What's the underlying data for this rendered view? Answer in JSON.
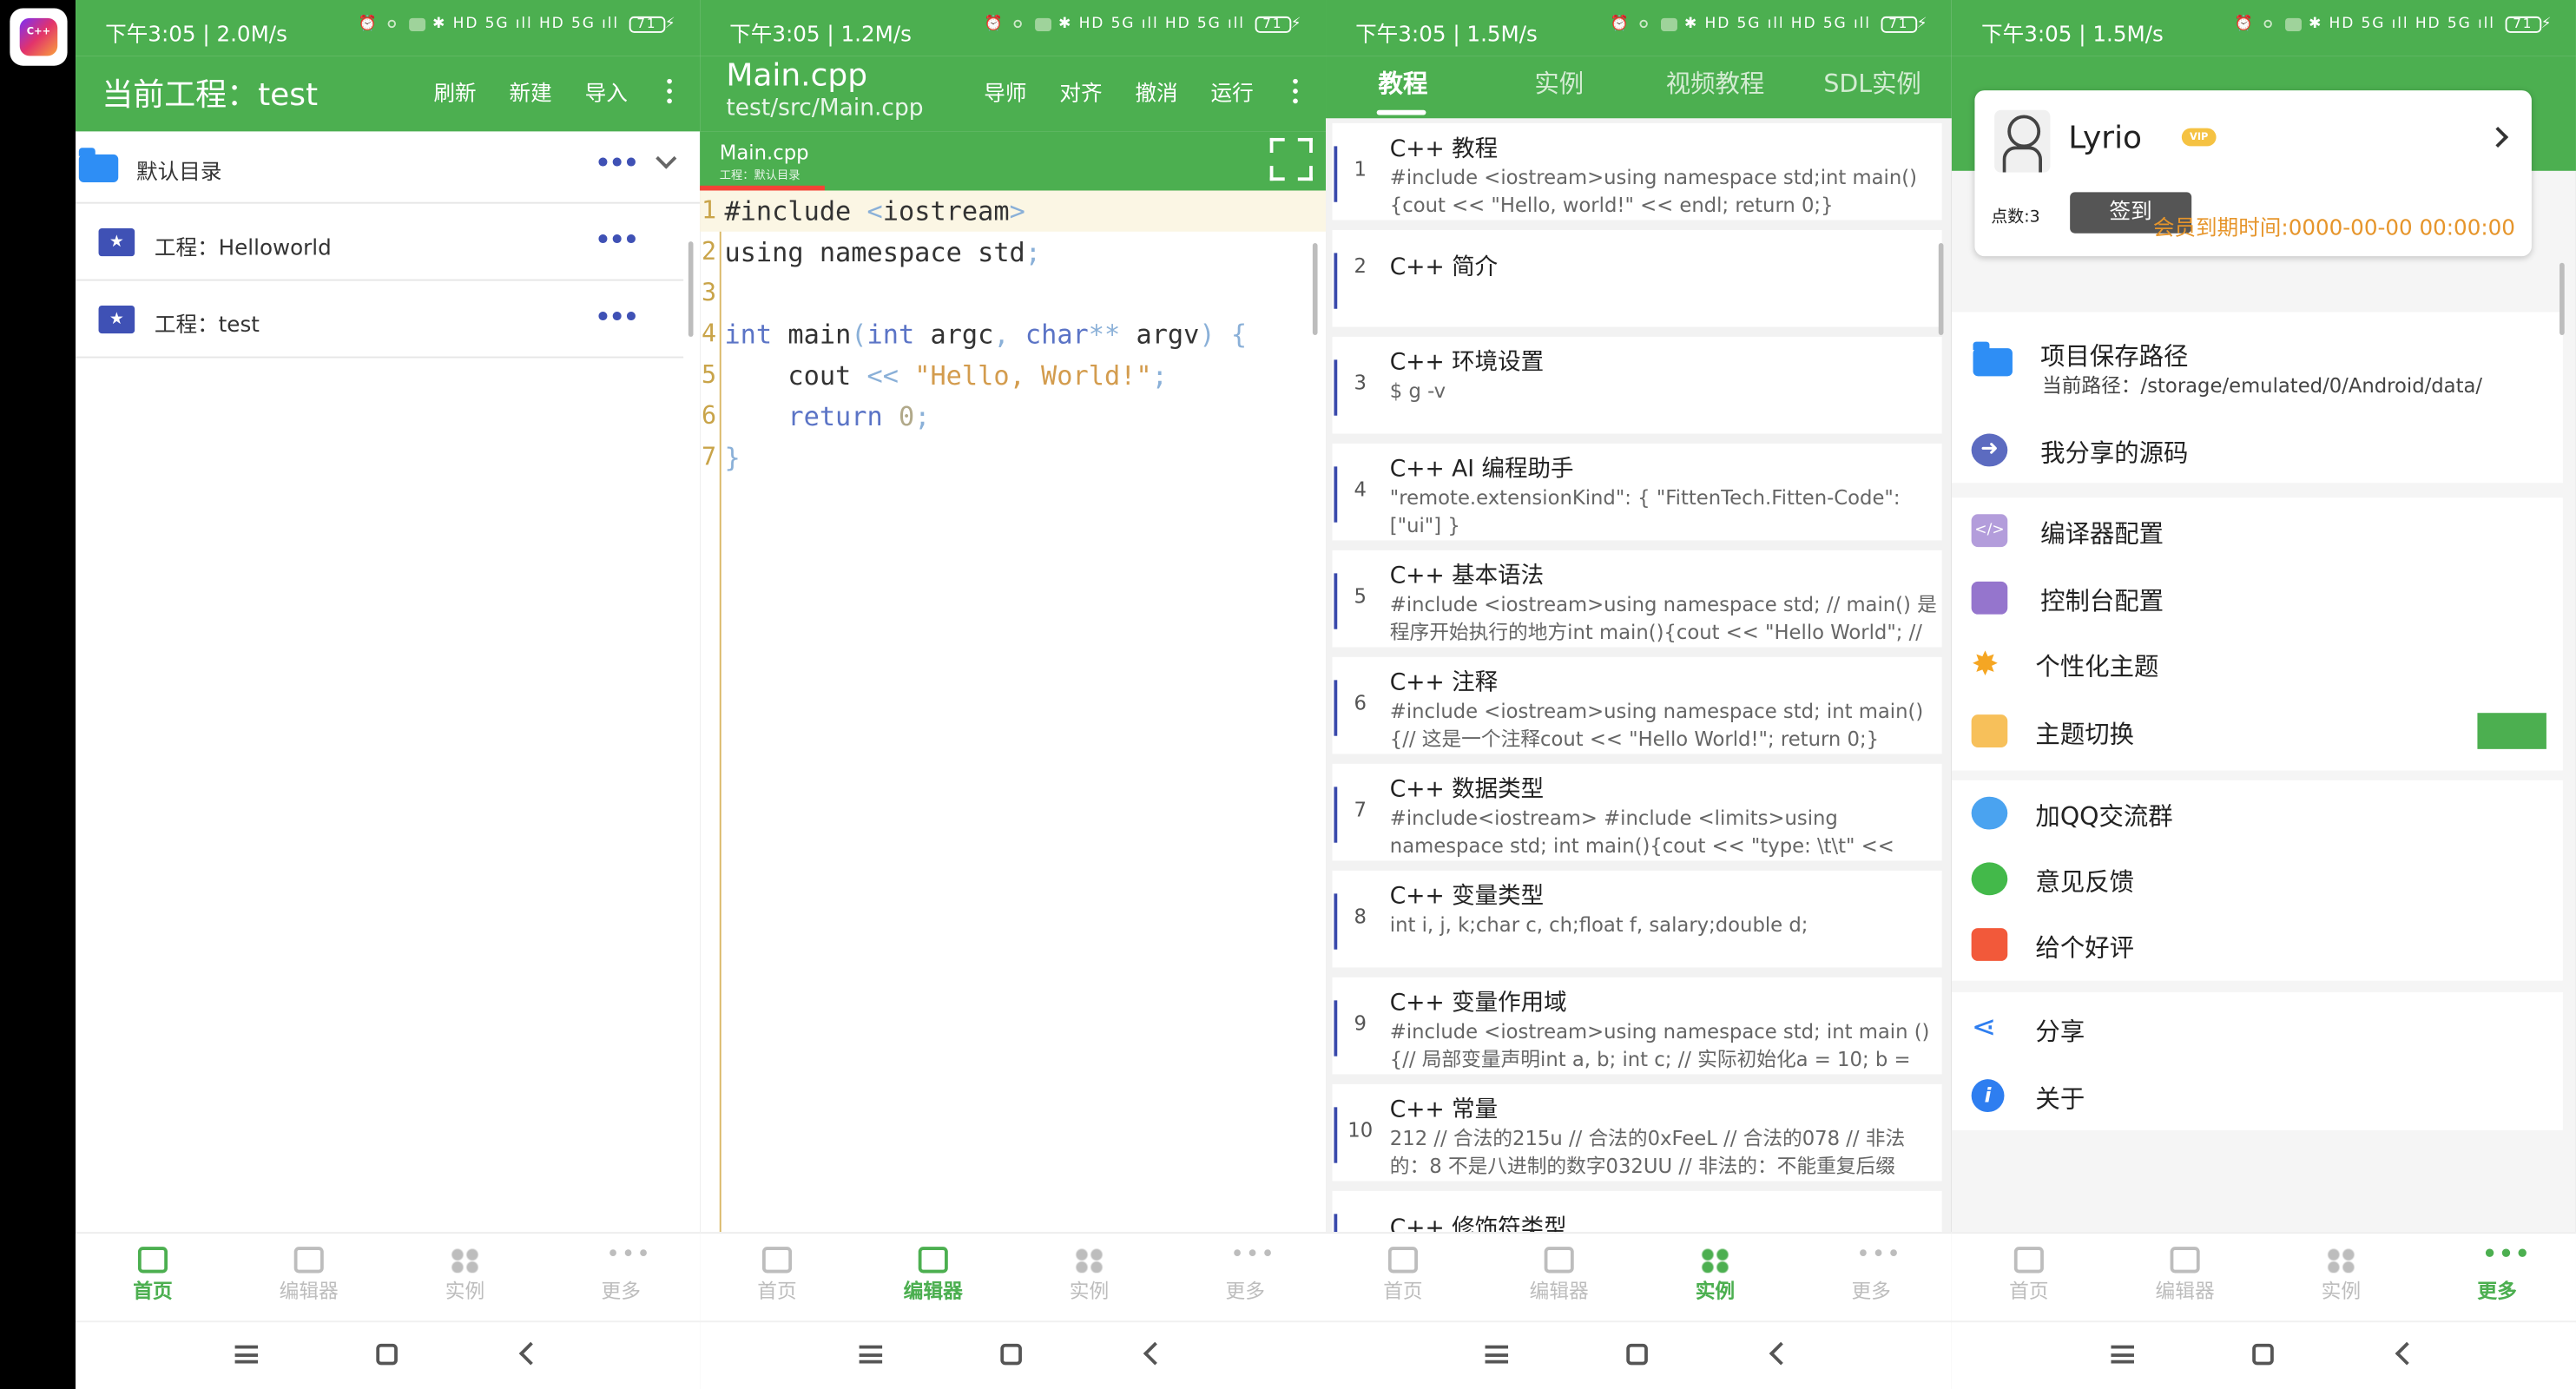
{
  "app_icon_text": "C++",
  "colors": {
    "accent": "#4caf50",
    "star": "#3f51b5",
    "vip_date": "#e6952b"
  },
  "panels": [
    {
      "status": {
        "time": "下午3:05 | 2.0M/s",
        "icons": "✱ HD 5G ıll HD 5G ıll",
        "battery": "71"
      },
      "title": "当前工程：test",
      "actions": [
        "刷新",
        "新建",
        "导入"
      ],
      "dir_label": "默认目录",
      "projects": [
        "工程：Helloworld",
        "工程：test"
      ]
    },
    {
      "status": {
        "time": "下午3:05 | 1.2M/s",
        "icons": "✱ HD 5G ıll HD 5G ıll",
        "battery": "71"
      },
      "title": "Main.cpp",
      "subtitle": "test/src/Main.cpp",
      "actions": [
        "导师",
        "对齐",
        "撤消",
        "运行"
      ],
      "tab_name": "Main.cpp",
      "tab_sub": "工程：默认目录",
      "code_lines": [
        "1",
        "2",
        "3",
        "4",
        "5",
        "6",
        "7"
      ]
    },
    {
      "status": {
        "time": "下午3:05 | 1.5M/s",
        "icons": "✱ HD 5G ıll HD 5G ıll",
        "battery": "71"
      },
      "tabs": [
        "教程",
        "实例",
        "视频教程",
        "SDL实例"
      ],
      "items": [
        {
          "n": "1",
          "title": "C++ 教程",
          "desc": "#include <iostream>using namespace std;int main(){cout << \"Hello, world!\" << endl;    return 0;}"
        },
        {
          "n": "2",
          "title": "C++ 简介",
          "desc": ""
        },
        {
          "n": "3",
          "title": "C++ 环境设置",
          "desc": "$ g  -v"
        },
        {
          "n": "4",
          "title": "C++ AI 编程助手",
          "desc": "\"remote.extensionKind\": { \"FittenTech.Fitten-Code\": [\"ui\"] }"
        },
        {
          "n": "5",
          "title": "C++ 基本语法",
          "desc": "#include <iostream>using namespace std; // main() 是程序开始执行的地方int main(){cout << \"Hello World\"; // 输"
        },
        {
          "n": "6",
          "title": "C++ 注释",
          "desc": "#include <iostream>using namespace std; int main() {// 这是一个注释cout << \"Hello World!\";  return 0;}"
        },
        {
          "n": "7",
          "title": "C++ 数据类型",
          "desc": "#include<iostream> #include <limits>using namespace std;    int main(){cout << \"type: \\t\\t\" <<"
        },
        {
          "n": "8",
          "title": "C++ 变量类型",
          "desc": "int i, j, k;char c, ch;float f, salary;double d;"
        },
        {
          "n": "9",
          "title": "C++ 变量作用域",
          "desc": "#include <iostream>using namespace std; int main (){// 局部变量声明int a, b;  int c;   // 实际初始化a = 10;  b ="
        },
        {
          "n": "10",
          "title": "C++ 常量",
          "desc": "212 // 合法的215u // 合法的0xFeeL // 合法的078 // 非法的：8 不是八进制的数字032UU // 非法的：不能重复后缀"
        },
        {
          "n": "",
          "title": "C++ 修饰符类型",
          "desc": ""
        }
      ]
    },
    {
      "status": {
        "time": "下午3:05 | 1.5M/s",
        "icons": "✱ HD 5G ıll HD 5G ıll",
        "battery": "71"
      },
      "profile": {
        "name": "Lyrio",
        "vip": "VIP",
        "points": "点数:3",
        "sign_button": "签到",
        "vip_expiry": "会员到期时间:0000-00-00 00:00:00"
      },
      "save_path_label": "项目保存路径",
      "save_path_value": "当前路径：/storage/emulated/0/Android/data/",
      "menu": {
        "shared_source": "我分享的源码",
        "compiler_config": "编译器配置",
        "console_config": "控制台配置",
        "personal_theme": "个性化主题",
        "theme_switch": "主题切换",
        "qq_group": "加QQ交流群",
        "feedback": "意见反馈",
        "rate": "给个好评",
        "share": "分享",
        "about": "关于"
      }
    }
  ],
  "bottom_nav": [
    "首页",
    "编辑器",
    "实例",
    "更多"
  ]
}
